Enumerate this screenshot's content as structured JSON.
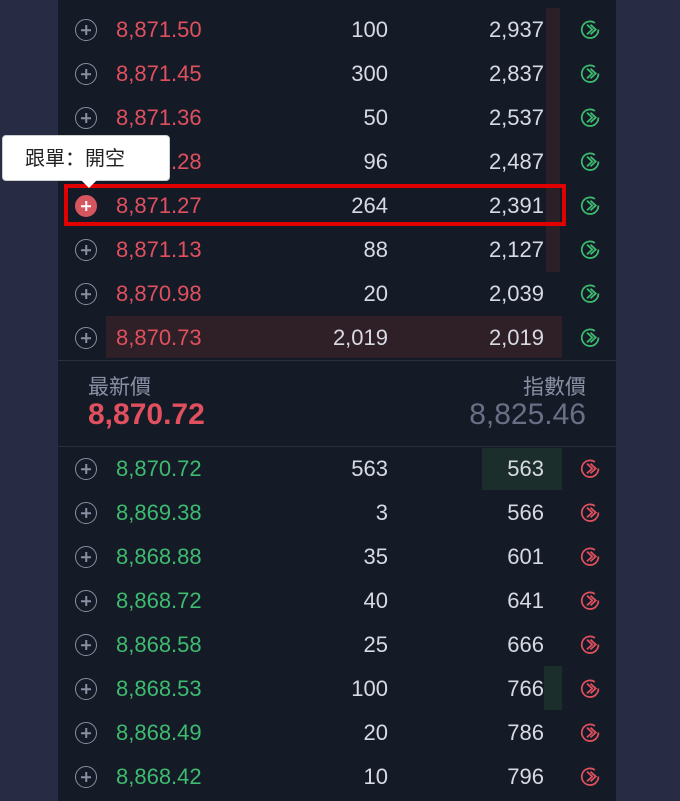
{
  "tooltip": {
    "text": "跟單：開空"
  },
  "asks": [
    {
      "price": "8,871.50",
      "qty": "100",
      "cum": "2,937"
    },
    {
      "price": "8,871.45",
      "qty": "300",
      "cum": "2,837"
    },
    {
      "price": "8,871.36",
      "qty": "50",
      "cum": "2,537"
    },
    {
      "price": "8,871.28",
      "qty": "96",
      "cum": "2,487"
    },
    {
      "price": "8,871.27",
      "qty": "264",
      "cum": "2,391"
    },
    {
      "price": "8,871.13",
      "qty": "88",
      "cum": "2,127"
    },
    {
      "price": "8,870.98",
      "qty": "20",
      "cum": "2,039"
    },
    {
      "price": "8,870.73",
      "qty": "2,019",
      "cum": "2,019"
    }
  ],
  "middle": {
    "last_label": "最新價",
    "last_value": "8,870.72",
    "index_label": "指數價",
    "index_value": "8,825.46"
  },
  "bids": [
    {
      "price": "8,870.72",
      "qty": "563",
      "cum": "563"
    },
    {
      "price": "8,869.38",
      "qty": "3",
      "cum": "566"
    },
    {
      "price": "8,868.88",
      "qty": "35",
      "cum": "601"
    },
    {
      "price": "8,868.72",
      "qty": "40",
      "cum": "641"
    },
    {
      "price": "8,868.58",
      "qty": "25",
      "cum": "666"
    },
    {
      "price": "8,868.53",
      "qty": "100",
      "cum": "766"
    },
    {
      "price": "8,868.49",
      "qty": "20",
      "cum": "786"
    },
    {
      "price": "8,868.42",
      "qty": "10",
      "cum": "796"
    }
  ],
  "colors": {
    "ask": "#e0505e",
    "bid": "#3dbb6f",
    "highlight": "#e00000",
    "panel": "#151a27",
    "page": "#272c44"
  },
  "icons": {
    "row_add": "plus-circle-icon",
    "ask_action": "green-arrow-circle-icon",
    "bid_action": "red-arrow-circle-icon"
  }
}
